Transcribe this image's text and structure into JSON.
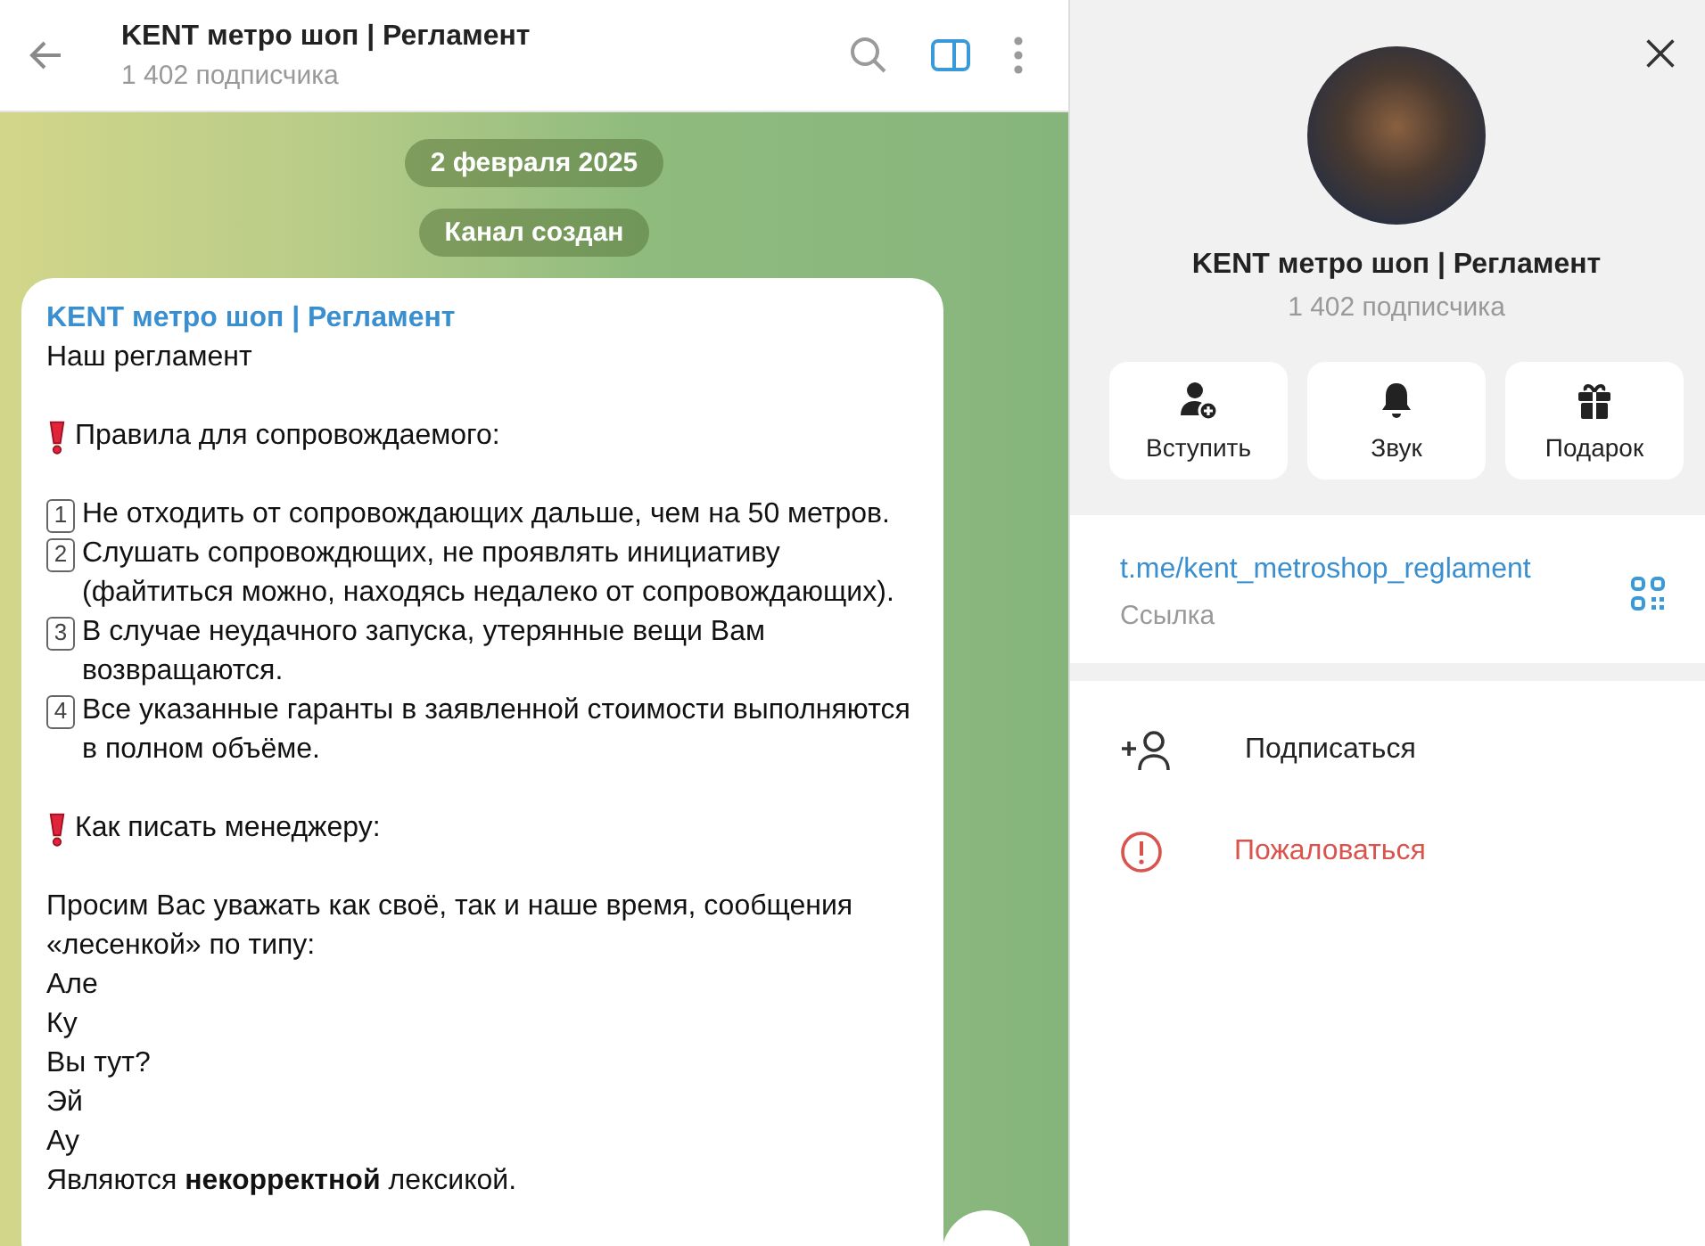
{
  "header": {
    "title": "KENT метро шоп | Регламент",
    "subtitle": "1 402 подписчика"
  },
  "service_messages": [
    "2 февраля 2025",
    "Канал создан"
  ],
  "message": {
    "author": "KENT метро шоп | Регламент",
    "lines": [
      {
        "kind": "text",
        "text": "Наш регламент"
      },
      {
        "kind": "blank"
      },
      {
        "kind": "heading",
        "text": "Правила для сопровождаемого:"
      },
      {
        "kind": "blank"
      },
      {
        "kind": "numbered",
        "marker": "1",
        "text": "Не отходить от сопровождающих дальше, чем на 50 метров."
      },
      {
        "kind": "numbered",
        "marker": "2",
        "text": "Слушать сопровождющих, не проявлять инициативу (файтиться можно, находясь недалеко от сопровождающих)."
      },
      {
        "kind": "numbered",
        "marker": "3",
        "text": "В случае неудачного запуска, утерянные вещи Вам возвращаются."
      },
      {
        "kind": "numbered",
        "marker": "4",
        "text": "Все указанные гаранты в заявленной стоимости выполняются в полном объёме."
      },
      {
        "kind": "blank"
      },
      {
        "kind": "heading",
        "text": "Как писать менеджеру:"
      },
      {
        "kind": "blank"
      },
      {
        "kind": "text",
        "text": "Просим Вас уважать как своё, так и наше время, сообщения «лесенкой» по типу:"
      },
      {
        "kind": "text",
        "text": "Але"
      },
      {
        "kind": "text",
        "text": "Ку"
      },
      {
        "kind": "text",
        "text": "Вы тут?"
      },
      {
        "kind": "text",
        "text": "Эй"
      },
      {
        "kind": "text",
        "text": "Ау"
      },
      {
        "kind": "text",
        "text": "Являются **некорректной** лексикой."
      }
    ]
  },
  "profile": {
    "title": "KENT метро шоп | Регламент",
    "subtitle": "1 402 подписчика",
    "actions": [
      {
        "kind": "join",
        "label": "Вступить"
      },
      {
        "kind": "sound",
        "label": "Звук"
      },
      {
        "kind": "gift",
        "label": "Подарок"
      }
    ],
    "link": {
      "url": "t.me/kent_metroshop_reglament",
      "caption": "Ссылка"
    },
    "menu": [
      {
        "kind": "subscribe",
        "label": "Подписаться",
        "danger": false
      },
      {
        "kind": "report",
        "label": "Пожаловаться",
        "danger": true
      }
    ]
  }
}
